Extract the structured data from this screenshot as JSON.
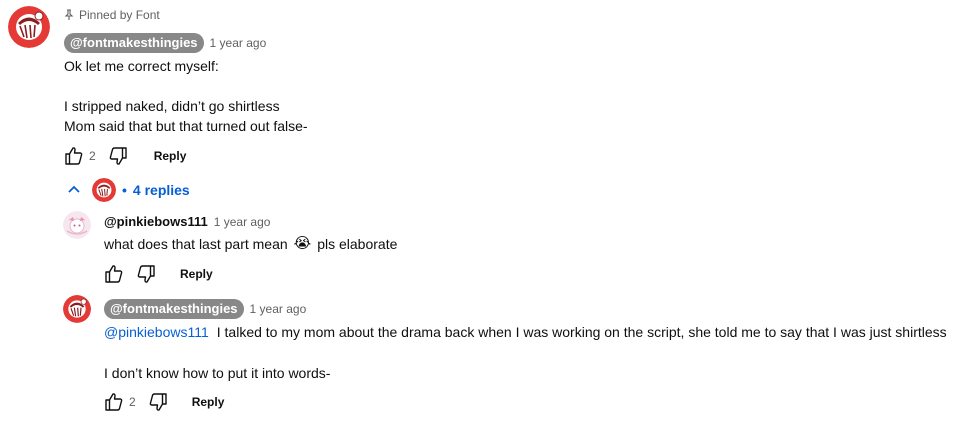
{
  "pinned": {
    "label": "Pinned by Font"
  },
  "top_comment": {
    "author": "@fontmakesthingies",
    "time": "1 year ago",
    "lines": [
      "Ok let me correct myself:",
      "",
      "I stripped naked, didn’t go shirtless",
      "Mom said that but that turned out false-"
    ],
    "likes": "2",
    "reply_label": "Reply"
  },
  "replies_toggle": {
    "count_label": "4 replies"
  },
  "replies": [
    {
      "author": "@pinkiebows111",
      "time": "1 year ago",
      "text": "what does that last part mean",
      "text_after_emoji": "pls elaborate",
      "emoji": "😭",
      "reply_label": "Reply"
    },
    {
      "author": "@fontmakesthingies",
      "time": "1 year ago",
      "mention": "@pinkiebows111",
      "text": "I talked to my mom about the drama back when I was working on the script, she told me to say that I was just shirtless",
      "text2": "I don’t know how to put it into words-",
      "likes": "2",
      "reply_label": "Reply"
    }
  ],
  "colors": {
    "link_blue": "#065fd4",
    "author_chip_bg": "#888888",
    "avatar_red": "#e53935",
    "meta_grey": "#606060"
  }
}
